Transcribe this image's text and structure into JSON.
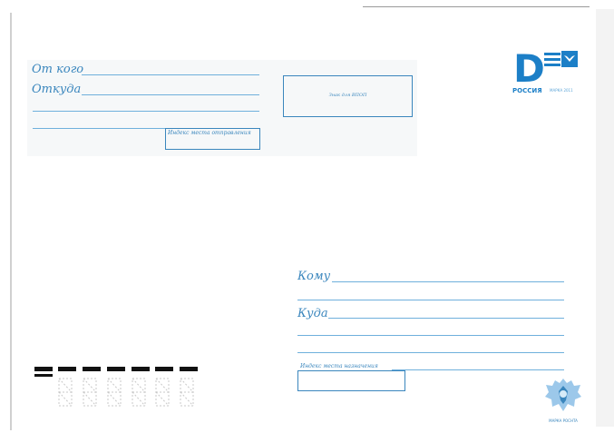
{
  "sender": {
    "from_label": "От кого",
    "where_label": "Откуда",
    "index_label": "Индекс места отправления"
  },
  "stamp": {
    "text": "Знак для ВПОП"
  },
  "logo": {
    "letter": "D",
    "name": "РОССИЯ",
    "sub": "МАРКА 2011"
  },
  "recipient": {
    "to_label": "Кому",
    "where_label": "Куда",
    "index_label": "Индекс места назначения"
  },
  "emblem": {
    "caption": "МАРКА POCHTA"
  },
  "colors": {
    "accent": "#3a86bd",
    "logo_blue": "#1c7fc7",
    "line_blue": "#6fb0dc"
  }
}
